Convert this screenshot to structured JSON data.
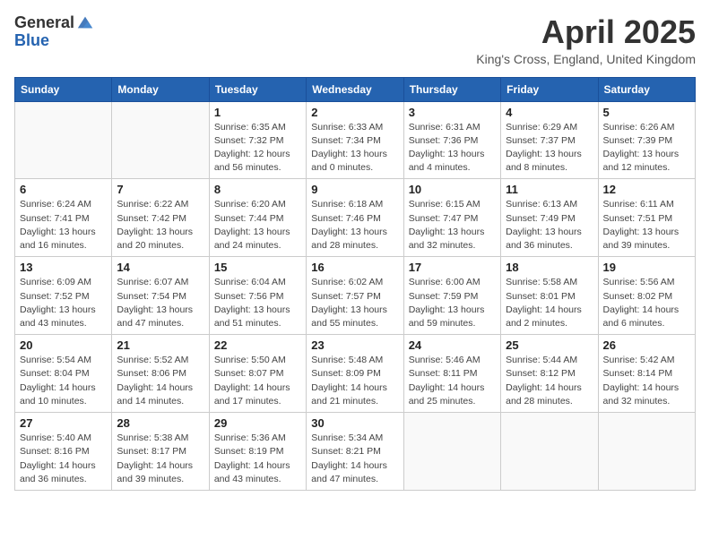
{
  "header": {
    "logo_general": "General",
    "logo_blue": "Blue",
    "title": "April 2025",
    "location": "King's Cross, England, United Kingdom"
  },
  "days_of_week": [
    "Sunday",
    "Monday",
    "Tuesday",
    "Wednesday",
    "Thursday",
    "Friday",
    "Saturday"
  ],
  "weeks": [
    [
      {
        "day": "",
        "sunrise": "",
        "sunset": "",
        "daylight": ""
      },
      {
        "day": "",
        "sunrise": "",
        "sunset": "",
        "daylight": ""
      },
      {
        "day": "1",
        "sunrise": "Sunrise: 6:35 AM",
        "sunset": "Sunset: 7:32 PM",
        "daylight": "Daylight: 12 hours and 56 minutes."
      },
      {
        "day": "2",
        "sunrise": "Sunrise: 6:33 AM",
        "sunset": "Sunset: 7:34 PM",
        "daylight": "Daylight: 13 hours and 0 minutes."
      },
      {
        "day": "3",
        "sunrise": "Sunrise: 6:31 AM",
        "sunset": "Sunset: 7:36 PM",
        "daylight": "Daylight: 13 hours and 4 minutes."
      },
      {
        "day": "4",
        "sunrise": "Sunrise: 6:29 AM",
        "sunset": "Sunset: 7:37 PM",
        "daylight": "Daylight: 13 hours and 8 minutes."
      },
      {
        "day": "5",
        "sunrise": "Sunrise: 6:26 AM",
        "sunset": "Sunset: 7:39 PM",
        "daylight": "Daylight: 13 hours and 12 minutes."
      }
    ],
    [
      {
        "day": "6",
        "sunrise": "Sunrise: 6:24 AM",
        "sunset": "Sunset: 7:41 PM",
        "daylight": "Daylight: 13 hours and 16 minutes."
      },
      {
        "day": "7",
        "sunrise": "Sunrise: 6:22 AM",
        "sunset": "Sunset: 7:42 PM",
        "daylight": "Daylight: 13 hours and 20 minutes."
      },
      {
        "day": "8",
        "sunrise": "Sunrise: 6:20 AM",
        "sunset": "Sunset: 7:44 PM",
        "daylight": "Daylight: 13 hours and 24 minutes."
      },
      {
        "day": "9",
        "sunrise": "Sunrise: 6:18 AM",
        "sunset": "Sunset: 7:46 PM",
        "daylight": "Daylight: 13 hours and 28 minutes."
      },
      {
        "day": "10",
        "sunrise": "Sunrise: 6:15 AM",
        "sunset": "Sunset: 7:47 PM",
        "daylight": "Daylight: 13 hours and 32 minutes."
      },
      {
        "day": "11",
        "sunrise": "Sunrise: 6:13 AM",
        "sunset": "Sunset: 7:49 PM",
        "daylight": "Daylight: 13 hours and 36 minutes."
      },
      {
        "day": "12",
        "sunrise": "Sunrise: 6:11 AM",
        "sunset": "Sunset: 7:51 PM",
        "daylight": "Daylight: 13 hours and 39 minutes."
      }
    ],
    [
      {
        "day": "13",
        "sunrise": "Sunrise: 6:09 AM",
        "sunset": "Sunset: 7:52 PM",
        "daylight": "Daylight: 13 hours and 43 minutes."
      },
      {
        "day": "14",
        "sunrise": "Sunrise: 6:07 AM",
        "sunset": "Sunset: 7:54 PM",
        "daylight": "Daylight: 13 hours and 47 minutes."
      },
      {
        "day": "15",
        "sunrise": "Sunrise: 6:04 AM",
        "sunset": "Sunset: 7:56 PM",
        "daylight": "Daylight: 13 hours and 51 minutes."
      },
      {
        "day": "16",
        "sunrise": "Sunrise: 6:02 AM",
        "sunset": "Sunset: 7:57 PM",
        "daylight": "Daylight: 13 hours and 55 minutes."
      },
      {
        "day": "17",
        "sunrise": "Sunrise: 6:00 AM",
        "sunset": "Sunset: 7:59 PM",
        "daylight": "Daylight: 13 hours and 59 minutes."
      },
      {
        "day": "18",
        "sunrise": "Sunrise: 5:58 AM",
        "sunset": "Sunset: 8:01 PM",
        "daylight": "Daylight: 14 hours and 2 minutes."
      },
      {
        "day": "19",
        "sunrise": "Sunrise: 5:56 AM",
        "sunset": "Sunset: 8:02 PM",
        "daylight": "Daylight: 14 hours and 6 minutes."
      }
    ],
    [
      {
        "day": "20",
        "sunrise": "Sunrise: 5:54 AM",
        "sunset": "Sunset: 8:04 PM",
        "daylight": "Daylight: 14 hours and 10 minutes."
      },
      {
        "day": "21",
        "sunrise": "Sunrise: 5:52 AM",
        "sunset": "Sunset: 8:06 PM",
        "daylight": "Daylight: 14 hours and 14 minutes."
      },
      {
        "day": "22",
        "sunrise": "Sunrise: 5:50 AM",
        "sunset": "Sunset: 8:07 PM",
        "daylight": "Daylight: 14 hours and 17 minutes."
      },
      {
        "day": "23",
        "sunrise": "Sunrise: 5:48 AM",
        "sunset": "Sunset: 8:09 PM",
        "daylight": "Daylight: 14 hours and 21 minutes."
      },
      {
        "day": "24",
        "sunrise": "Sunrise: 5:46 AM",
        "sunset": "Sunset: 8:11 PM",
        "daylight": "Daylight: 14 hours and 25 minutes."
      },
      {
        "day": "25",
        "sunrise": "Sunrise: 5:44 AM",
        "sunset": "Sunset: 8:12 PM",
        "daylight": "Daylight: 14 hours and 28 minutes."
      },
      {
        "day": "26",
        "sunrise": "Sunrise: 5:42 AM",
        "sunset": "Sunset: 8:14 PM",
        "daylight": "Daylight: 14 hours and 32 minutes."
      }
    ],
    [
      {
        "day": "27",
        "sunrise": "Sunrise: 5:40 AM",
        "sunset": "Sunset: 8:16 PM",
        "daylight": "Daylight: 14 hours and 36 minutes."
      },
      {
        "day": "28",
        "sunrise": "Sunrise: 5:38 AM",
        "sunset": "Sunset: 8:17 PM",
        "daylight": "Daylight: 14 hours and 39 minutes."
      },
      {
        "day": "29",
        "sunrise": "Sunrise: 5:36 AM",
        "sunset": "Sunset: 8:19 PM",
        "daylight": "Daylight: 14 hours and 43 minutes."
      },
      {
        "day": "30",
        "sunrise": "Sunrise: 5:34 AM",
        "sunset": "Sunset: 8:21 PM",
        "daylight": "Daylight: 14 hours and 47 minutes."
      },
      {
        "day": "",
        "sunrise": "",
        "sunset": "",
        "daylight": ""
      },
      {
        "day": "",
        "sunrise": "",
        "sunset": "",
        "daylight": ""
      },
      {
        "day": "",
        "sunrise": "",
        "sunset": "",
        "daylight": ""
      }
    ]
  ]
}
